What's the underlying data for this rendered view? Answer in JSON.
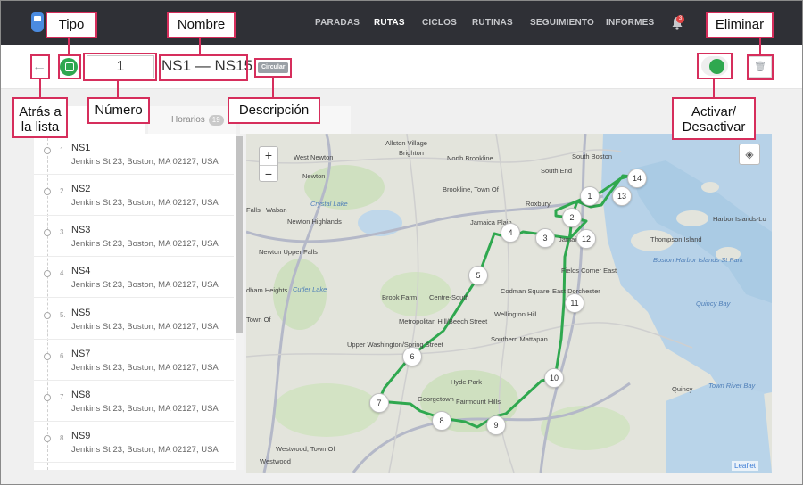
{
  "nav": {
    "items": [
      "PARADAS",
      "RUTAS",
      "CICLOS",
      "RUTINAS",
      "SEGUIMIENTO",
      "INFORMES"
    ],
    "active": "RUTAS",
    "notification_count": "3"
  },
  "header": {
    "route_number": "1",
    "route_name": "NS1 — NS15",
    "description_badge": "Circular",
    "active": true
  },
  "tabs": {
    "horarios_label": "Horarios",
    "horarios_count": "19"
  },
  "stops": [
    {
      "index": "1.",
      "name": "NS1",
      "address": "Jenkins St 23, Boston, MA 02127, USA"
    },
    {
      "index": "2.",
      "name": "NS2",
      "address": "Jenkins St 23, Boston, MA 02127, USA"
    },
    {
      "index": "3.",
      "name": "NS3",
      "address": "Jenkins St 23, Boston, MA 02127, USA"
    },
    {
      "index": "4.",
      "name": "NS4",
      "address": "Jenkins St 23, Boston, MA 02127, USA"
    },
    {
      "index": "5.",
      "name": "NS5",
      "address": "Jenkins St 23, Boston, MA 02127, USA"
    },
    {
      "index": "6.",
      "name": "NS7",
      "address": "Jenkins St 23, Boston, MA 02127, USA"
    },
    {
      "index": "7.",
      "name": "NS8",
      "address": "Jenkins St 23, Boston, MA 02127, USA"
    },
    {
      "index": "8.",
      "name": "NS9",
      "address": "Jenkins St 23, Boston, MA 02127, USA"
    }
  ],
  "map": {
    "route_color": "#2fa84f",
    "attribution": "Leaflet",
    "zoom_in": "+",
    "zoom_out": "−",
    "labels": [
      "Allston Village",
      "Brighton",
      "North Brookline",
      "South Boston",
      "South End",
      "West Newton",
      "Newton",
      "Brookline, Town Of",
      "Roxbury",
      "Crystal Lake",
      "Falls",
      "Waban",
      "Newton Highlands",
      "Jamaica Plain",
      "Newton Upper Falls",
      "Thompson Island",
      "Harbor Islands-Lo",
      "Boston Harbor Islands St Park",
      "Brook Farm",
      "Centre-South",
      "Codman Square",
      "East Dorchester",
      "Fields Corner East",
      "Wellington Hill",
      "Metropolitan Hill/Beech Street",
      "Upper Washington/Spring Street",
      "Southern Mattapan",
      "Quincy Bay",
      "Hyde Park",
      "Georgetown",
      "Fairmount Hills",
      "Quincy",
      "Town River Bay",
      "Westwood, Town Of",
      "Westwood",
      "Town Of",
      "dham Heights",
      "Cutler Lake",
      "Jamaica Hill"
    ],
    "markers": [
      "1",
      "2",
      "3",
      "4",
      "5",
      "6",
      "7",
      "8",
      "9",
      "10",
      "11",
      "12",
      "13",
      "14"
    ]
  },
  "annotations": {
    "tipo": "Tipo",
    "nombre": "Nombre",
    "eliminar": "Eliminar",
    "atras_line1": "Atrás a",
    "atras_line2": "la lista",
    "numero": "Número",
    "descripcion": "Descripción",
    "activar_line1": "Activar/",
    "activar_line2": "Desactivar"
  }
}
